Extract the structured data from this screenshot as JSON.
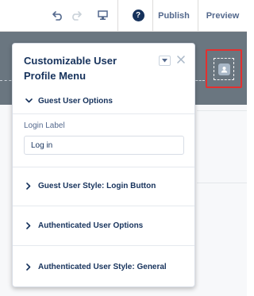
{
  "toolbar": {
    "undo_icon": "undo-icon",
    "redo_icon": "redo-icon",
    "device_icon": "desktop-icon",
    "help_symbol": "?",
    "publish_label": "Publish",
    "preview_label": "Preview"
  },
  "header": {
    "profile_icon": "user-avatar-icon",
    "highlight_color": "#e3302f"
  },
  "panel": {
    "title": "Customizable User Profile Menu",
    "sections": [
      {
        "label": "Guest User Options",
        "expanded": true
      },
      {
        "label": "Guest User Style: Login Button",
        "expanded": false
      },
      {
        "label": "Authenticated User Options",
        "expanded": false
      },
      {
        "label": "Authenticated User Style: General",
        "expanded": false
      }
    ],
    "login_label": {
      "label": "Login Label",
      "value": "Log in"
    }
  },
  "colors": {
    "text": "#16325c",
    "muted": "#54698d",
    "header_band": "#6a7680"
  }
}
